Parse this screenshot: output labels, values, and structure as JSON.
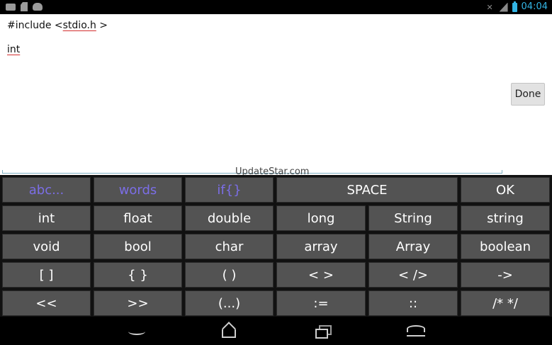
{
  "status_bar": {
    "time": "04:04",
    "left_icons": [
      "message-icon",
      "sd-card-icon",
      "cat-icon"
    ],
    "right_icons": [
      "mute-icon",
      "signal-icon",
      "battery-icon"
    ],
    "accent_color": "#33b5e5"
  },
  "editor": {
    "line1_prefix": "#include <",
    "line1_word": "stdio.h",
    "line1_suffix": " >",
    "line2": "int",
    "done_label": "Done",
    "watermark": "UpdateStar.com"
  },
  "keyboard": {
    "mode_color": "#7b6ee6",
    "row1": [
      "abc...",
      "words",
      "if{}",
      "SPACE",
      "OK"
    ],
    "row2": [
      "int",
      "float",
      "double",
      "long",
      "String",
      "string"
    ],
    "row3": [
      "void",
      "bool",
      "char",
      "array",
      "Array",
      "boolean"
    ],
    "row4": [
      "[ ]",
      "{ }",
      "( )",
      "< >",
      "< />",
      "->"
    ],
    "row5": [
      "<<",
      ">>",
      "(...)",
      ":=",
      "::",
      "/* */"
    ]
  },
  "nav_bar": {
    "icons": [
      "back-icon",
      "home-icon",
      "recent-apps-icon",
      "keyboard-hide-icon"
    ]
  }
}
